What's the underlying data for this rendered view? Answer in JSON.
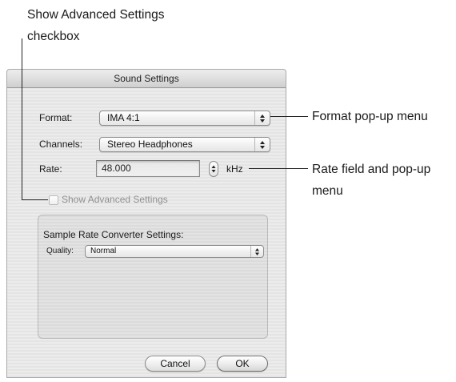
{
  "callouts": {
    "advanced_checkbox_line1": "Show Advanced Settings",
    "advanced_checkbox_line2": "checkbox",
    "format_popup": "Format pop-up menu",
    "rate_field_line1": "Rate field and pop-up",
    "rate_field_line2": "menu"
  },
  "dialog": {
    "title": "Sound Settings",
    "format": {
      "label": "Format:",
      "value": "IMA 4:1"
    },
    "channels": {
      "label": "Channels:",
      "value": "Stereo Headphones"
    },
    "rate": {
      "label": "Rate:",
      "value": "48.000",
      "unit": "kHz"
    },
    "show_advanced": {
      "label": "Show Advanced Settings",
      "checked": false,
      "enabled": false
    },
    "src_group": {
      "title": "Sample Rate Converter Settings:",
      "quality_label": "Quality:",
      "quality_value": "Normal"
    },
    "buttons": {
      "cancel": "Cancel",
      "ok": "OK"
    }
  },
  "icons": {
    "popup_arrows": "up-down-arrows-icon",
    "stepper_arrows": "stepper-arrows-icon"
  }
}
